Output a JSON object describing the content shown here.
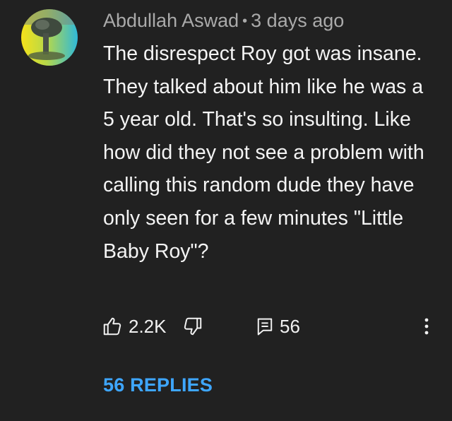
{
  "comment": {
    "author": "Abdullah Aswad",
    "separator": "•",
    "timestamp": "3 days ago",
    "text": "The disrespect Roy got was insane. They talked about him like he was a 5 year old. That's so insulting. Like how did they not see a problem with calling this random dude they have only seen for a few minutes \"Little Baby Roy\"?",
    "avatar_icon": "avatar-image",
    "actions": {
      "like_icon": "thumbs-up-icon",
      "like_count": "2.2K",
      "dislike_icon": "thumbs-down-icon",
      "reply_icon": "comment-icon",
      "reply_count": "56",
      "more_icon": "more-vertical-icon"
    },
    "replies_link": "56 REPLIES"
  },
  "colors": {
    "background": "#212121",
    "meta_text": "#aaaaaa",
    "body_text": "#f4f4f4",
    "link": "#3ea6ff"
  }
}
